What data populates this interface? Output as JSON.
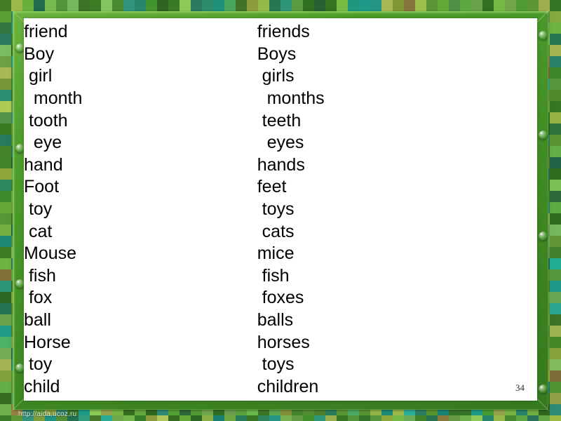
{
  "slide": {
    "page_number": "34",
    "watermark": "http://aida.ucoz.ru"
  },
  "theme": {
    "frame_green": "#4e9e2c",
    "frame_green_dark": "#357a1e",
    "frame_green_light": "#8ecb5e",
    "panel_background": "#ffffff",
    "text_color": "#000000"
  },
  "word_list": {
    "rows": [
      {
        "singular": "friend",
        "plural": "friends"
      },
      {
        "singular": "Boy",
        "plural": "Boys"
      },
      {
        "singular": " girl",
        "plural": " girls"
      },
      {
        "singular": "  month",
        "plural": "  months"
      },
      {
        "singular": " tooth",
        "plural": " teeth"
      },
      {
        "singular": "  eye",
        "plural": "  eyes"
      },
      {
        "singular": "hand",
        "plural": "hands"
      },
      {
        "singular": "Foot",
        "plural": "feet"
      },
      {
        "singular": " toy",
        "plural": " toys"
      },
      {
        "singular": " cat",
        "plural": " cats"
      },
      {
        "singular": "Mouse",
        "plural": "mice"
      },
      {
        "singular": " fish",
        "plural": " fish"
      },
      {
        "singular": " fox",
        "plural": " foxes"
      },
      {
        "singular": "ball",
        "plural": "balls"
      },
      {
        "singular": "Horse",
        "plural": "horses"
      },
      {
        "singular": " toy",
        "plural": " toys"
      },
      {
        "singular": "child",
        "plural": "children"
      }
    ]
  },
  "mosaic": {
    "tile_colors": [
      "#4f8a2a",
      "#2f6b1f",
      "#6fae4a",
      "#1f9c86",
      "#3d7a24",
      "#8fa83c",
      "#2a8f72",
      "#5a9e33",
      "#7fb84f",
      "#356f22",
      "#46a05c",
      "#63a23a",
      "#2b7b55",
      "#9bb84a",
      "#2d6b3a",
      "#57a03f",
      "#1d8f7e",
      "#78b057",
      "#86743a",
      "#3f8f2c",
      "#55994a",
      "#2e7e62",
      "#6ba83e",
      "#4a7f2c",
      "#9aa84e",
      "#2b8a6e",
      "#5f9e35",
      "#35731f",
      "#70b25a",
      "#27a08c",
      "#4d8f30",
      "#8cae44",
      "#336f28",
      "#5ba13c",
      "#2a8266",
      "#74ab4b",
      "#8e9c3e",
      "#3a8228",
      "#62a744",
      "#246f52",
      "#6ea93d",
      "#437f2b",
      "#a0b352",
      "#2f8a74",
      "#5d9a37",
      "#3b7a25",
      "#77b451",
      "#1f9a84",
      "#4a9230",
      "#84a940"
    ]
  }
}
